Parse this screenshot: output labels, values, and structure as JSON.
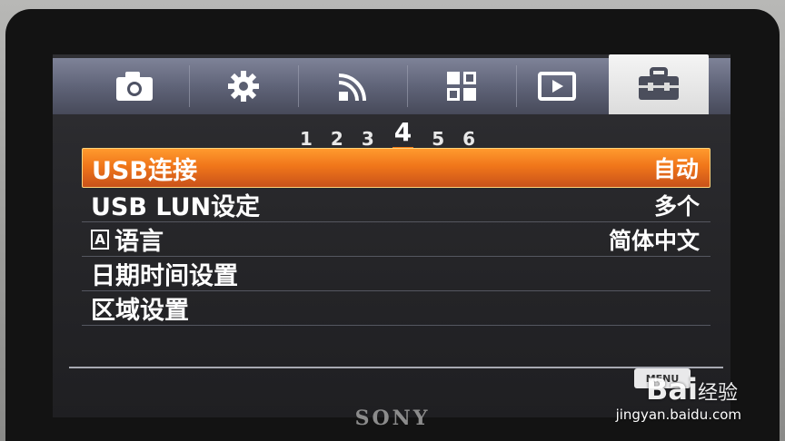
{
  "device": {
    "brand": "SONY"
  },
  "tabs": [
    {
      "name": "camera"
    },
    {
      "name": "custom-settings"
    },
    {
      "name": "wireless"
    },
    {
      "name": "applications"
    },
    {
      "name": "playback"
    },
    {
      "name": "setup",
      "active": true
    }
  ],
  "pages": [
    "1",
    "2",
    "3",
    "4",
    "5",
    "6"
  ],
  "current_page": "4",
  "menu": {
    "items": [
      {
        "label": "USB连接",
        "value": "自动",
        "selected": true
      },
      {
        "label": "USB LUN设定",
        "value": "多个"
      },
      {
        "label": "语言",
        "value": "简体中文",
        "icon": "A"
      },
      {
        "label": "日期时间设置",
        "value": ""
      },
      {
        "label": "区域设置",
        "value": ""
      }
    ]
  },
  "bottom": {
    "menu_label": "MENU"
  },
  "watermark": {
    "brand": "Bai",
    "suffix": "经验",
    "url": "jingyan.baidu.com"
  },
  "colors": {
    "accent": "#f0761a",
    "tab_active": "#f4f4f4",
    "tab_bar": "#5d6175"
  }
}
